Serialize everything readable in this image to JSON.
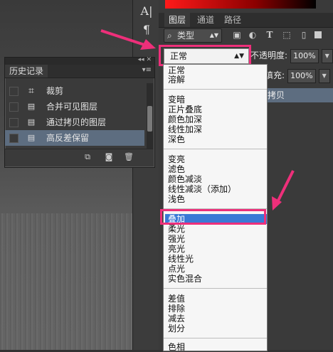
{
  "panel_tabs": [
    "图层",
    "通道",
    "路径"
  ],
  "layer_filter": {
    "label": "类型",
    "icons": [
      "image-filter-icon",
      "adjustment-filter-icon",
      "text-filter-icon",
      "shape-filter-icon",
      "smart-object-filter-icon"
    ]
  },
  "blend_mode": {
    "current": "正常"
  },
  "opacity": {
    "label": "不透明度:",
    "value": "100%"
  },
  "fill": {
    "label": "填充:",
    "value": "100%"
  },
  "selected_layer": {
    "label": "拷贝"
  },
  "history": {
    "title": "历史记录",
    "items": [
      {
        "label": "裁剪",
        "icon": "crop-icon"
      },
      {
        "label": "合并可见图层",
        "icon": "document-icon"
      },
      {
        "label": "通过拷贝的图层",
        "icon": "document-icon"
      },
      {
        "label": "高反差保留",
        "icon": "document-icon",
        "selected": true
      }
    ]
  },
  "blend_menu": {
    "groups": [
      [
        "正常",
        "溶解"
      ],
      [
        "变暗",
        "正片叠底",
        "颜色加深",
        "线性加深",
        "深色"
      ],
      [
        "变亮",
        "滤色",
        "颜色减淡",
        "线性减淡（添加）",
        "浅色"
      ],
      [
        "叠加",
        "柔光",
        "强光",
        "亮光",
        "线性光",
        "点光",
        "实色混合"
      ],
      [
        "差值",
        "排除",
        "减去",
        "划分"
      ],
      [
        "色相"
      ]
    ],
    "highlighted": "叠加"
  },
  "colors": {
    "highlight": "#3a79d6",
    "annotation": "#ee2f7a",
    "selection_row": "#5d6d80"
  }
}
